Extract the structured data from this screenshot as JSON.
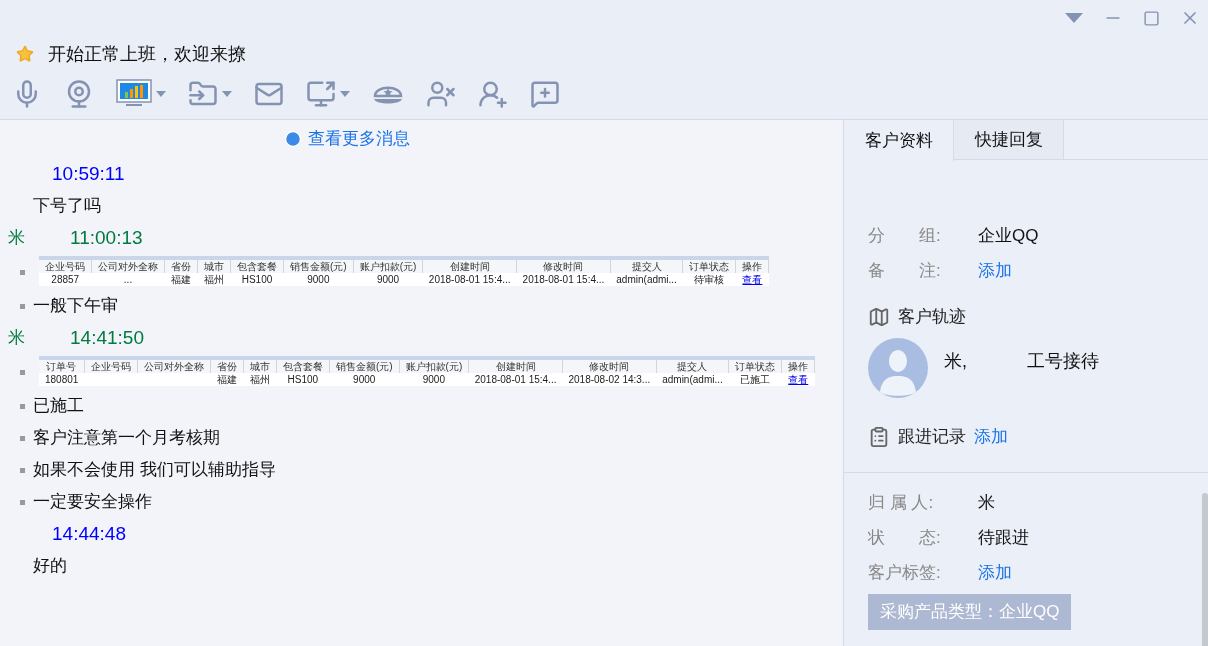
{
  "status_line": {
    "text": "开始正常上班，欢迎来撩"
  },
  "toolbar": [
    {
      "kind": "mic",
      "dropdown": false
    },
    {
      "kind": "camera",
      "dropdown": false
    },
    {
      "kind": "screen",
      "dropdown": true
    },
    {
      "kind": "file",
      "dropdown": true
    },
    {
      "kind": "mail",
      "dropdown": false
    },
    {
      "kind": "share",
      "dropdown": true
    },
    {
      "kind": "hat",
      "dropdown": false
    },
    {
      "kind": "block",
      "dropdown": false
    },
    {
      "kind": "transfer",
      "dropdown": false
    },
    {
      "kind": "note",
      "dropdown": false
    }
  ],
  "chat": {
    "more_link": "查看更多消息",
    "groups": [
      {
        "time": "10:59:11",
        "color": "#0000ff",
        "items": [
          {
            "kind": "text",
            "text": "下号了吗"
          }
        ]
      },
      {
        "sender": "米",
        "time": "11:00:13",
        "color": "#007a3d",
        "items": [
          {
            "kind": "table",
            "columns": [
              "企业号码",
              "公司对外全称",
              "省份",
              "城市",
              "包含套餐",
              "销售金额(元)",
              "账户扣款(元)",
              "创建时间",
              "修改时间",
              "提交人",
              "订单状态",
              "操作"
            ],
            "row": [
              {
                "kind": "text",
                "text": "28857"
              },
              {
                "kind": "text",
                "text": "..."
              },
              {
                "kind": "text",
                "text": "福建"
              },
              {
                "kind": "text",
                "text": "福州"
              },
              {
                "kind": "text",
                "text": "HS100"
              },
              {
                "kind": "text",
                "text": "9000"
              },
              {
                "kind": "text",
                "text": "9000"
              },
              {
                "kind": "text",
                "text": "2018-08-01 15:4..."
              },
              {
                "kind": "text",
                "text": "2018-08-01 15:4..."
              },
              {
                "kind": "text",
                "text": "admin(admi..."
              },
              {
                "kind": "text",
                "text": "待审核"
              },
              {
                "kind": "link",
                "text": "查看"
              }
            ]
          },
          {
            "kind": "bullet",
            "text": "一般下午审"
          }
        ]
      },
      {
        "sender": "米",
        "time": "14:41:50",
        "color": "#007a3d",
        "items": [
          {
            "kind": "table",
            "columns": [
              "订单号",
              "企业号码",
              "公司对外全称",
              "省份",
              "城市",
              "包含套餐",
              "销售金额(元)",
              "账户扣款(元)",
              "创建时间",
              "修改时间",
              "提交人",
              "订单状态",
              "操作"
            ],
            "row": [
              {
                "kind": "text",
                "text": "180801"
              },
              {
                "kind": "blank"
              },
              {
                "kind": "blank"
              },
              {
                "kind": "text",
                "text": "福建"
              },
              {
                "kind": "text",
                "text": "福州"
              },
              {
                "kind": "text",
                "text": "HS100"
              },
              {
                "kind": "text",
                "text": "9000"
              },
              {
                "kind": "text",
                "text": "9000"
              },
              {
                "kind": "text",
                "text": "2018-08-01 15:4..."
              },
              {
                "kind": "text",
                "text": "2018-08-02 14:3..."
              },
              {
                "kind": "text",
                "text": "admin(admi..."
              },
              {
                "kind": "text",
                "text": "已施工"
              },
              {
                "kind": "link",
                "text": "查看"
              }
            ]
          },
          {
            "kind": "bullet",
            "text": "已施工"
          },
          {
            "kind": "bullet",
            "text": "客户注意第一个月考核期"
          },
          {
            "kind": "bullet",
            "text": "如果不会使用 我们可以辅助指导"
          },
          {
            "kind": "bullet",
            "text": "一定要安全操作"
          }
        ]
      },
      {
        "time": "14:44:48",
        "color": "#0000ff",
        "items": [
          {
            "kind": "text",
            "text": "好的"
          }
        ]
      }
    ]
  },
  "panel": {
    "tabs": [
      {
        "label": "客户资料",
        "selected": true
      },
      {
        "label": "快捷回复",
        "selected": false
      }
    ],
    "fields": [
      {
        "label": "分　　组:",
        "value": "企业QQ",
        "kind": "text"
      },
      {
        "label": "备　　注:",
        "value": "添加",
        "kind": "link"
      }
    ],
    "track": {
      "title": "客户轨迹",
      "agent": "米,",
      "agent_note": "工号接待"
    },
    "followup": {
      "title": "跟进记录",
      "link": "添加"
    },
    "details": [
      {
        "label": "归 属 人:",
        "value": "米",
        "kind": "text"
      },
      {
        "label": "状　　态:",
        "value": "待跟进",
        "kind": "text"
      },
      {
        "label": "客户标签:",
        "value": "添加",
        "kind": "link"
      }
    ],
    "tag": "采购产品类型：企业QQ"
  }
}
